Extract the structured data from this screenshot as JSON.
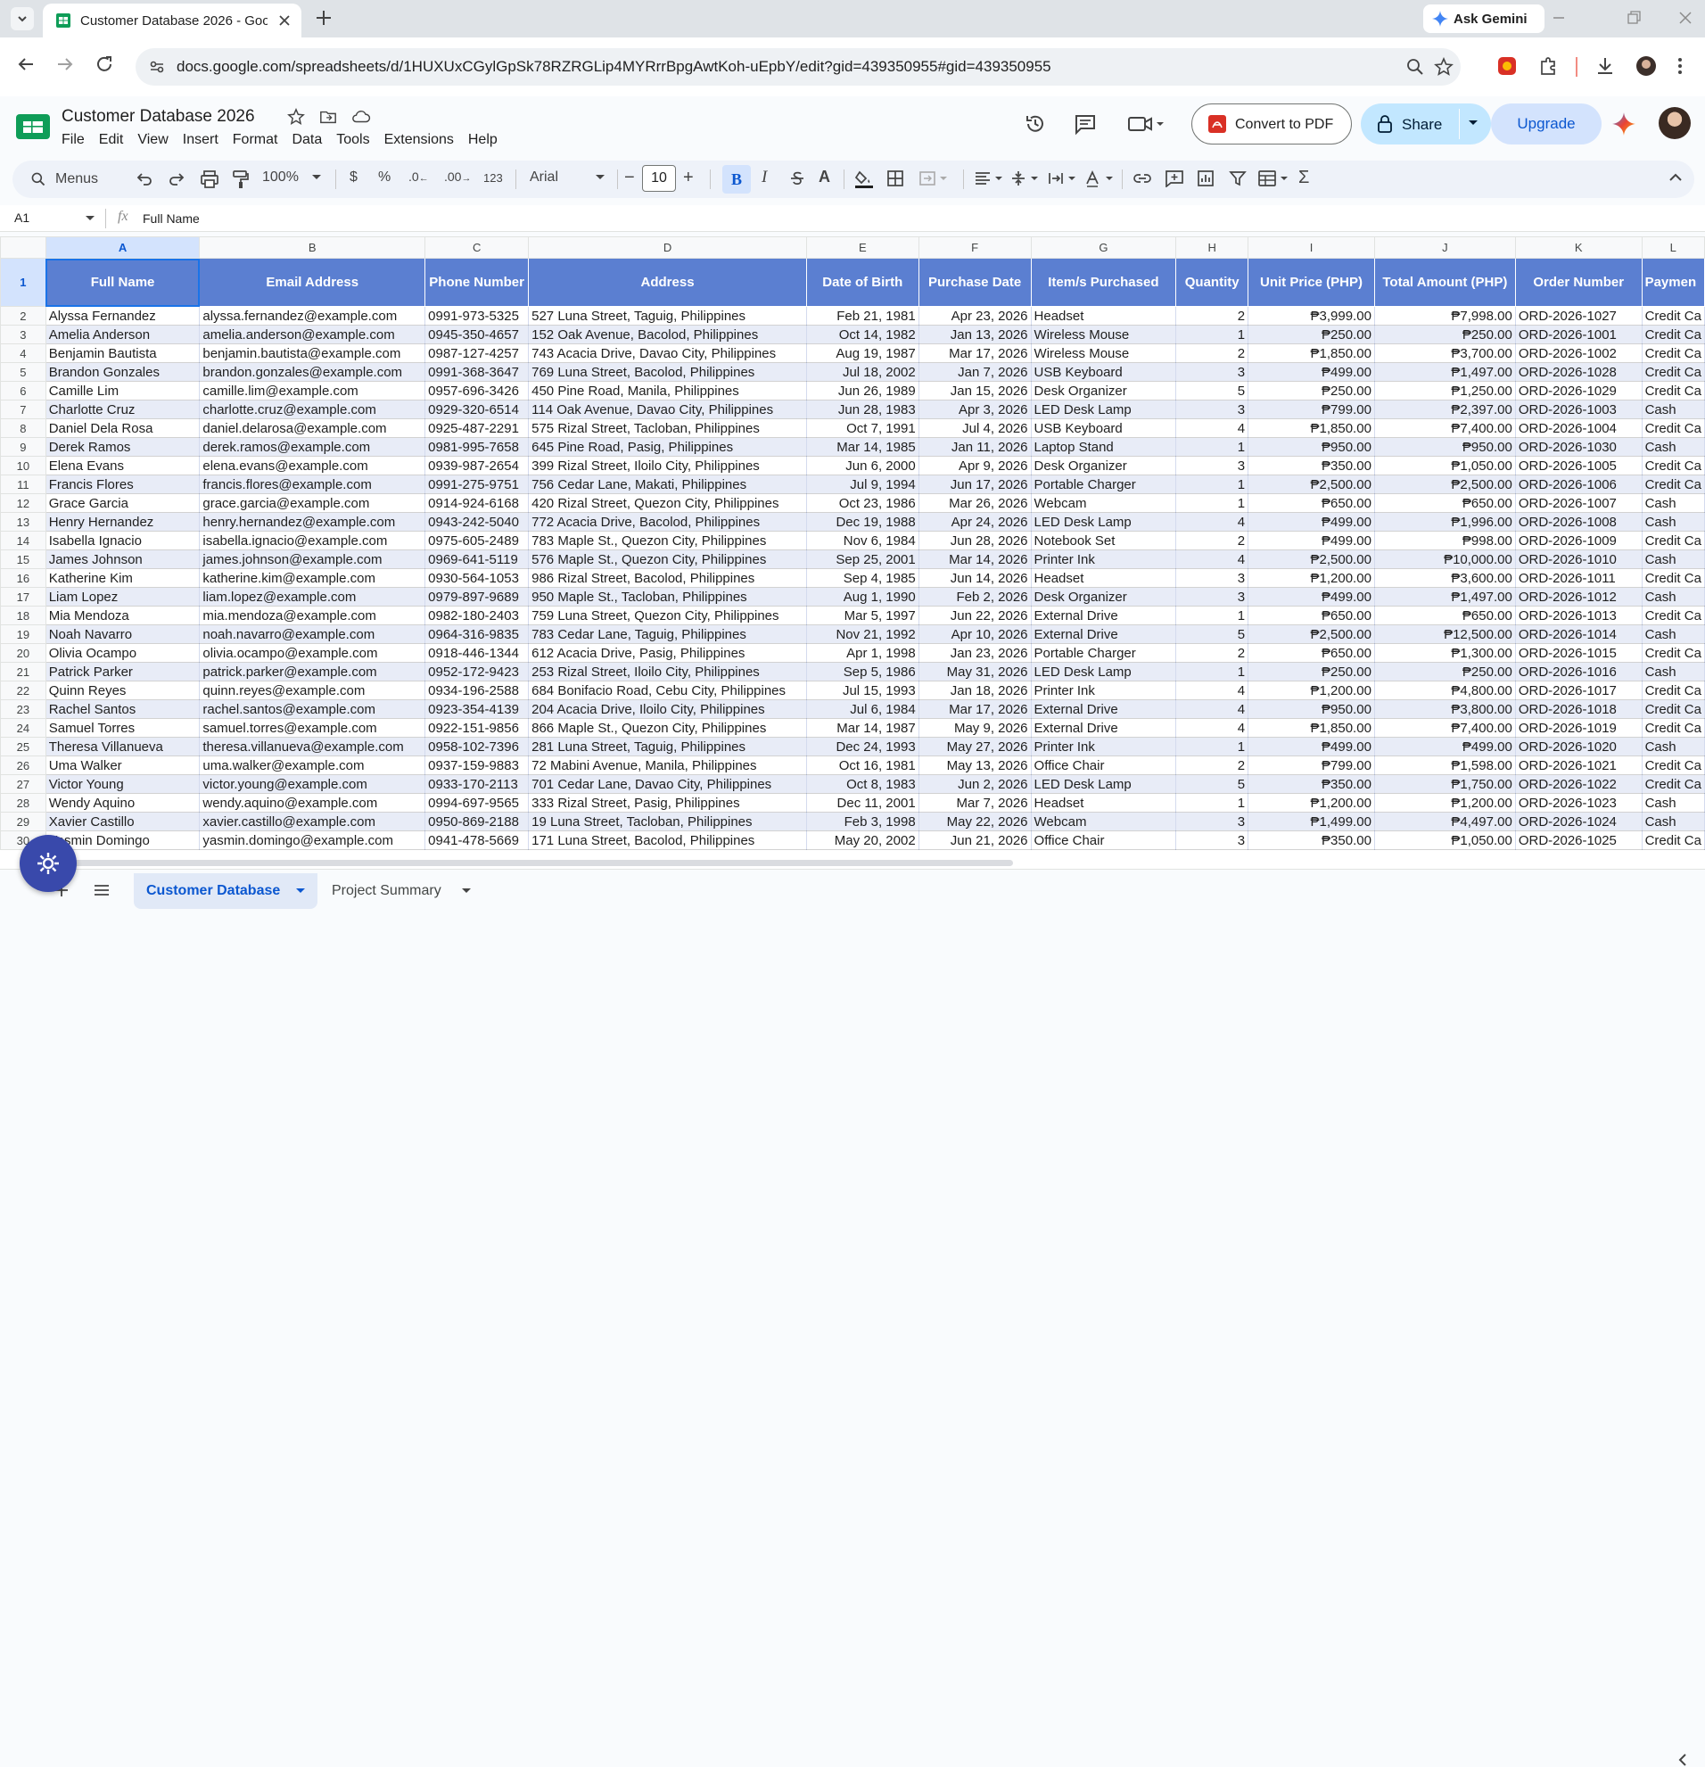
{
  "browser": {
    "tab_title": "Customer Database 2026 - Goo",
    "gemini_label": "Ask Gemini",
    "url": "docs.google.com/spreadsheets/d/1HUXUxCGylGpSk78RZRGLip4MYRrrBpgAwtKoh-uEpbY/edit?gid=439350955#gid=439350955"
  },
  "sheets": {
    "doc_title": "Customer Database 2026",
    "menus": [
      "File",
      "Edit",
      "View",
      "Insert",
      "Format",
      "Data",
      "Tools",
      "Extensions",
      "Help"
    ],
    "convert_label": "Convert to PDF",
    "share_label": "Share",
    "upgrade_label": "Upgrade"
  },
  "toolbar": {
    "menus_label": "Menus",
    "zoom": "100%",
    "currency": "$",
    "percent": "%",
    "dec_less": ".0",
    "dec_more": ".00",
    "number_format": "123",
    "font": "Arial",
    "font_size": "10",
    "bold": "B",
    "italic": "I",
    "textcolor": "A"
  },
  "formula_bar": {
    "cell_ref": "A1",
    "fx": "fx",
    "value": "Full Name"
  },
  "grid": {
    "columns": [
      "A",
      "B",
      "C",
      "D",
      "E",
      "F",
      "G",
      "H",
      "I",
      "J",
      "K",
      "L"
    ],
    "headers": [
      "Full Name",
      "Email Address",
      "Phone Number",
      "Address",
      "Date of Birth",
      "Purchase Date",
      "Item/s Purchased",
      "Quantity",
      "Unit Price (PHP)",
      "Total Amount (PHP)",
      "Order Number",
      "Paymen"
    ],
    "rows": [
      [
        "2",
        "Alyssa Fernandez",
        "alyssa.fernandez@example.com",
        "0991-973-5325",
        "527 Luna Street, Taguig, Philippines",
        "Feb 21, 1981",
        "Apr 23, 2026",
        "Headset",
        "2",
        "₱3,999.00",
        "₱7,998.00",
        "ORD-2026-1027",
        "Credit Ca"
      ],
      [
        "3",
        "Amelia Anderson",
        "amelia.anderson@example.com",
        "0945-350-4657",
        "152 Oak Avenue, Bacolod, Philippines",
        "Oct 14, 1982",
        "Jan 13, 2026",
        "Wireless Mouse",
        "1",
        "₱250.00",
        "₱250.00",
        "ORD-2026-1001",
        "Credit Ca"
      ],
      [
        "4",
        "Benjamin Bautista",
        "benjamin.bautista@example.com",
        "0987-127-4257",
        "743 Acacia Drive, Davao City, Philippines",
        "Aug 19, 1987",
        "Mar 17, 2026",
        "Wireless Mouse",
        "2",
        "₱1,850.00",
        "₱3,700.00",
        "ORD-2026-1002",
        "Credit Ca"
      ],
      [
        "5",
        "Brandon Gonzales",
        "brandon.gonzales@example.com",
        "0991-368-3647",
        "769 Luna Street, Bacolod, Philippines",
        "Jul 18, 2002",
        "Jan 7, 2026",
        "USB Keyboard",
        "3",
        "₱499.00",
        "₱1,497.00",
        "ORD-2026-1028",
        "Credit Ca"
      ],
      [
        "6",
        "Camille Lim",
        "camille.lim@example.com",
        "0957-696-3426",
        "450 Pine Road, Manila, Philippines",
        "Jun 26, 1989",
        "Jan 15, 2026",
        "Desk Organizer",
        "5",
        "₱250.00",
        "₱1,250.00",
        "ORD-2026-1029",
        "Credit Ca"
      ],
      [
        "7",
        "Charlotte Cruz",
        "charlotte.cruz@example.com",
        "0929-320-6514",
        "114 Oak Avenue, Davao City, Philippines",
        "Jun 28, 1983",
        "Apr 3, 2026",
        "LED Desk Lamp",
        "3",
        "₱799.00",
        "₱2,397.00",
        "ORD-2026-1003",
        "Cash"
      ],
      [
        "8",
        "Daniel Dela Rosa",
        "daniel.delarosa@example.com",
        "0925-487-2291",
        "575 Rizal Street, Tacloban, Philippines",
        "Oct 7, 1991",
        "Jul 4, 2026",
        "USB Keyboard",
        "4",
        "₱1,850.00",
        "₱7,400.00",
        "ORD-2026-1004",
        "Credit Ca"
      ],
      [
        "9",
        "Derek Ramos",
        "derek.ramos@example.com",
        "0981-995-7658",
        "645 Pine Road, Pasig, Philippines",
        "Mar 14, 1985",
        "Jan 11, 2026",
        "Laptop Stand",
        "1",
        "₱950.00",
        "₱950.00",
        "ORD-2026-1030",
        "Cash"
      ],
      [
        "10",
        "Elena Evans",
        "elena.evans@example.com",
        "0939-987-2654",
        "399 Rizal Street, Iloilo City, Philippines",
        "Jun 6, 2000",
        "Apr 9, 2026",
        "Desk Organizer",
        "3",
        "₱350.00",
        "₱1,050.00",
        "ORD-2026-1005",
        "Credit Ca"
      ],
      [
        "11",
        "Francis Flores",
        "francis.flores@example.com",
        "0991-275-9751",
        "756 Cedar Lane, Makati, Philippines",
        "Jul 9, 1994",
        "Jun 17, 2026",
        "Portable Charger",
        "1",
        "₱2,500.00",
        "₱2,500.00",
        "ORD-2026-1006",
        "Credit Ca"
      ],
      [
        "12",
        "Grace Garcia",
        "grace.garcia@example.com",
        "0914-924-6168",
        "420 Rizal Street, Quezon City, Philippines",
        "Oct 23, 1986",
        "Mar 26, 2026",
        "Webcam",
        "1",
        "₱650.00",
        "₱650.00",
        "ORD-2026-1007",
        "Cash"
      ],
      [
        "13",
        "Henry Hernandez",
        "henry.hernandez@example.com",
        "0943-242-5040",
        "772 Acacia Drive, Bacolod, Philippines",
        "Dec 19, 1988",
        "Apr 24, 2026",
        "LED Desk Lamp",
        "4",
        "₱499.00",
        "₱1,996.00",
        "ORD-2026-1008",
        "Cash"
      ],
      [
        "14",
        "Isabella Ignacio",
        "isabella.ignacio@example.com",
        "0975-605-2489",
        "783 Maple St., Quezon City, Philippines",
        "Nov 6, 1984",
        "Jun 28, 2026",
        "Notebook Set",
        "2",
        "₱499.00",
        "₱998.00",
        "ORD-2026-1009",
        "Credit Ca"
      ],
      [
        "15",
        "James Johnson",
        "james.johnson@example.com",
        "0969-641-5119",
        "576 Maple St., Quezon City, Philippines",
        "Sep 25, 2001",
        "Mar 14, 2026",
        "Printer Ink",
        "4",
        "₱2,500.00",
        "₱10,000.00",
        "ORD-2026-1010",
        "Cash"
      ],
      [
        "16",
        "Katherine Kim",
        "katherine.kim@example.com",
        "0930-564-1053",
        "986 Rizal Street, Bacolod, Philippines",
        "Sep 4, 1985",
        "Jun 14, 2026",
        "Headset",
        "3",
        "₱1,200.00",
        "₱3,600.00",
        "ORD-2026-1011",
        "Credit Ca"
      ],
      [
        "17",
        "Liam Lopez",
        "liam.lopez@example.com",
        "0979-897-9689",
        "950 Maple St., Tacloban, Philippines",
        "Aug 1, 1990",
        "Feb 2, 2026",
        "Desk Organizer",
        "3",
        "₱499.00",
        "₱1,497.00",
        "ORD-2026-1012",
        "Cash"
      ],
      [
        "18",
        "Mia Mendoza",
        "mia.mendoza@example.com",
        "0982-180-2403",
        "759 Luna Street, Quezon City, Philippines",
        "Mar 5, 1997",
        "Jun 22, 2026",
        "External Drive",
        "1",
        "₱650.00",
        "₱650.00",
        "ORD-2026-1013",
        "Credit Ca"
      ],
      [
        "19",
        "Noah Navarro",
        "noah.navarro@example.com",
        "0964-316-9835",
        "783 Cedar Lane, Taguig, Philippines",
        "Nov 21, 1992",
        "Apr 10, 2026",
        "External Drive",
        "5",
        "₱2,500.00",
        "₱12,500.00",
        "ORD-2026-1014",
        "Cash"
      ],
      [
        "20",
        "Olivia Ocampo",
        "olivia.ocampo@example.com",
        "0918-446-1344",
        "612 Acacia Drive, Pasig, Philippines",
        "Apr 1, 1998",
        "Jan 23, 2026",
        "Portable Charger",
        "2",
        "₱650.00",
        "₱1,300.00",
        "ORD-2026-1015",
        "Credit Ca"
      ],
      [
        "21",
        "Patrick Parker",
        "patrick.parker@example.com",
        "0952-172-9423",
        "253 Rizal Street, Iloilo City, Philippines",
        "Sep 5, 1986",
        "May 31, 2026",
        "LED Desk Lamp",
        "1",
        "₱250.00",
        "₱250.00",
        "ORD-2026-1016",
        "Cash"
      ],
      [
        "22",
        "Quinn Reyes",
        "quinn.reyes@example.com",
        "0934-196-2588",
        "684 Bonifacio Road, Cebu City, Philippines",
        "Jul 15, 1993",
        "Jan 18, 2026",
        "Printer Ink",
        "4",
        "₱1,200.00",
        "₱4,800.00",
        "ORD-2026-1017",
        "Credit Ca"
      ],
      [
        "23",
        "Rachel Santos",
        "rachel.santos@example.com",
        "0923-354-4139",
        "204 Acacia Drive, Iloilo City, Philippines",
        "Jul 6, 1984",
        "Mar 17, 2026",
        "External Drive",
        "4",
        "₱950.00",
        "₱3,800.00",
        "ORD-2026-1018",
        "Credit Ca"
      ],
      [
        "24",
        "Samuel Torres",
        "samuel.torres@example.com",
        "0922-151-9856",
        "866 Maple St., Quezon City, Philippines",
        "Mar 14, 1987",
        "May 9, 2026",
        "External Drive",
        "4",
        "₱1,850.00",
        "₱7,400.00",
        "ORD-2026-1019",
        "Credit Ca"
      ],
      [
        "25",
        "Theresa Villanueva",
        "theresa.villanueva@example.com",
        "0958-102-7396",
        "281 Luna Street, Taguig, Philippines",
        "Dec 24, 1993",
        "May 27, 2026",
        "Printer Ink",
        "1",
        "₱499.00",
        "₱499.00",
        "ORD-2026-1020",
        "Cash"
      ],
      [
        "26",
        "Uma Walker",
        "uma.walker@example.com",
        "0937-159-9883",
        "72 Mabini Avenue, Manila, Philippines",
        "Oct 16, 1981",
        "May 13, 2026",
        "Office Chair",
        "2",
        "₱799.00",
        "₱1,598.00",
        "ORD-2026-1021",
        "Credit Ca"
      ],
      [
        "27",
        "Victor Young",
        "victor.young@example.com",
        "0933-170-2113",
        "701 Cedar Lane, Davao City, Philippines",
        "Oct 8, 1983",
        "Jun 2, 2026",
        "LED Desk Lamp",
        "5",
        "₱350.00",
        "₱1,750.00",
        "ORD-2026-1022",
        "Credit Ca"
      ],
      [
        "28",
        "Wendy Aquino",
        "wendy.aquino@example.com",
        "0994-697-9565",
        "333 Rizal Street, Pasig, Philippines",
        "Dec 11, 2001",
        "Mar 7, 2026",
        "Headset",
        "1",
        "₱1,200.00",
        "₱1,200.00",
        "ORD-2026-1023",
        "Cash"
      ],
      [
        "29",
        "Xavier Castillo",
        "xavier.castillo@example.com",
        "0950-869-2188",
        "19 Luna Street, Tacloban, Philippines",
        "Feb 3, 1998",
        "May 22, 2026",
        "Webcam",
        "3",
        "₱1,499.00",
        "₱4,497.00",
        "ORD-2026-1024",
        "Cash"
      ],
      [
        "30",
        "Yasmin Domingo",
        "yasmin.domingo@example.com",
        "0941-478-5669",
        "171 Luna Street, Bacolod, Philippines",
        "May 20, 2002",
        "Jun 21, 2026",
        "Office Chair",
        "3",
        "₱350.00",
        "₱1,050.00",
        "ORD-2026-1025",
        "Credit Ca"
      ]
    ]
  },
  "sheet_tabs": {
    "tabs": [
      "Customer Database",
      "Project Summary"
    ]
  },
  "colors": {
    "header_fill": "#5b7fd1",
    "band_fill": "#e8ecf7",
    "accent": "#0b57d0"
  }
}
